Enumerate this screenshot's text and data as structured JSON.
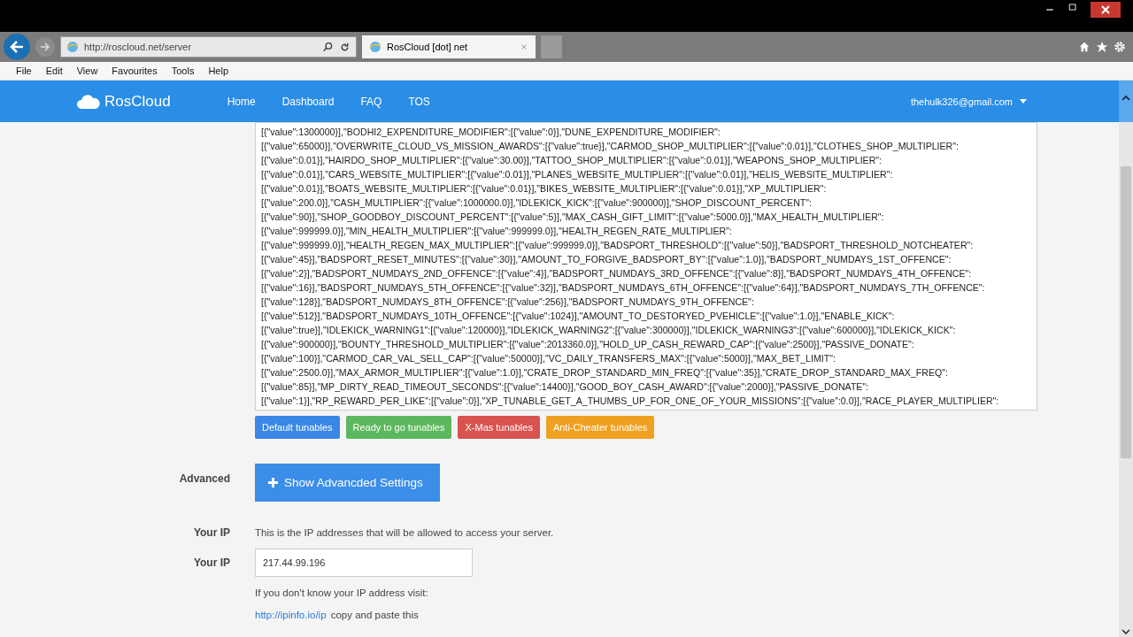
{
  "browser": {
    "address": "http://roscloud.net/server",
    "tab_title": "RosCloud [dot] net",
    "menu": [
      "File",
      "Edit",
      "View",
      "Favourites",
      "Tools",
      "Help"
    ]
  },
  "navbar": {
    "brand": "RosCloud",
    "links": [
      "Home",
      "Dashboard",
      "FAQ",
      "TOS"
    ],
    "user": "thehulk326@gmail.com"
  },
  "tunables_text": {
    "lines": [
      "[{\"value\":1300000}],\"BODHI2_EXPENDITURE_MODIFIER\":[{\"value\":0}],\"DUNE_EXPENDITURE_MODIFIER\":",
      "[{\"value\":65000}],\"OVERWRITE_CLOUD_VS_MISSION_AWARDS\":[{\"value\":true}],\"CARMOD_SHOP_MULTIPLIER\":[{\"value\":0.01}],\"CLOTHES_SHOP_MULTIPLIER\":",
      "[{\"value\":0.01}],\"HAIRDO_SHOP_MULTIPLIER\":[{\"value\":30.00}],\"TATTOO_SHOP_MULTIPLIER\":[{\"value\":0.01}],\"WEAPONS_SHOP_MULTIPLIER\":",
      "[{\"value\":0.01}],\"CARS_WEBSITE_MULTIPLIER\":[{\"value\":0.01}],\"PLANES_WEBSITE_MULTIPLIER\":[{\"value\":0.01}],\"HELIS_WEBSITE_MULTIPLIER\":",
      "[{\"value\":0.01}],\"BOATS_WEBSITE_MULTIPLIER\":[{\"value\":0.01}],\"BIKES_WEBSITE_MULTIPLIER\":[{\"value\":0.01}],\"XP_MULTIPLIER\":",
      "[{\"value\":200.0}],\"CASH_MULTIPLIER\":[{\"value\":1000000.0}],\"IDLEKICK_KICK\":[{\"value\":900000}],\"SHOP_DISCOUNT_PERCENT\":",
      "[{\"value\":90}],\"SHOP_GOODBOY_DISCOUNT_PERCENT\":[{\"value\":5}],\"MAX_CASH_GIFT_LIMIT\":[{\"value\":5000.0}],\"MAX_HEALTH_MULTIPLIER\":",
      "[{\"value\":999999.0}],\"MIN_HEALTH_MULTIPLIER\":[{\"value\":999999.0}],\"HEALTH_REGEN_RATE_MULTIPLIER\":",
      "[{\"value\":999999.0}],\"HEALTH_REGEN_MAX_MULTIPLIER\":[{\"value\":999999.0}],\"BADSPORT_THRESHOLD\":[{\"value\":50}],\"BADSPORT_THRESHOLD_NOTCHEATER\":",
      "[{\"value\":45}],\"BADSPORT_RESET_MINUTES\":[{\"value\":30}],\"AMOUNT_TO_FORGIVE_BADSPORT_BY\":[{\"value\":1.0}],\"BADSPORT_NUMDAYS_1ST_OFFENCE\":",
      "[{\"value\":2}],\"BADSPORT_NUMDAYS_2ND_OFFENCE\":[{\"value\":4}],\"BADSPORT_NUMDAYS_3RD_OFFENCE\":[{\"value\":8}],\"BADSPORT_NUMDAYS_4TH_OFFENCE\":",
      "[{\"value\":16}],\"BADSPORT_NUMDAYS_5TH_OFFENCE\":[{\"value\":32}],\"BADSPORT_NUMDAYS_6TH_OFFENCE\":[{\"value\":64}],\"BADSPORT_NUMDAYS_7TH_OFFENCE\":",
      "[{\"value\":128}],\"BADSPORT_NUMDAYS_8TH_OFFENCE\":[{\"value\":256}],\"BADSPORT_NUMDAYS_9TH_OFFENCE\":",
      "[{\"value\":512}],\"BADSPORT_NUMDAYS_10TH_OFFENCE\":[{\"value\":1024}],\"AMOUNT_TO_DESTORYED_PVEHICLE\":[{\"value\":1.0}],\"ENABLE_KICK\":",
      "[{\"value\":true}],\"IDLEKICK_WARNING1\":[{\"value\":120000}],\"IDLEKICK_WARNING2\":[{\"value\":300000}],\"IDLEKICK_WARNING3\":[{\"value\":600000}],\"IDLEKICK_KICK\":",
      "[{\"value\":900000}],\"BOUNTY_THRESHOLD_MULTIPLIER\":[{\"value\":2013360.0}],\"HOLD_UP_CASH_REWARD_CAP\":[{\"value\":2500}],\"PASSIVE_DONATE\":",
      "[{\"value\":100}],\"CARMOD_CAR_VAL_SELL_CAP\":[{\"value\":50000}],\"VC_DAILY_TRANSFERS_MAX\":[{\"value\":5000}],\"MAX_BET_LIMIT\":",
      "[{\"value\":2500.0}],\"MAX_ARMOR_MULTIPLIER\":[{\"value\":1.0}],\"CRATE_DROP_STANDARD_MIN_FREQ\":[{\"value\":35}],\"CRATE_DROP_STANDARD_MAX_FREQ\":",
      "[{\"value\":85}],\"MP_DIRTY_READ_TIMEOUT_SECONDS\":[{\"value\":14400}],\"GOOD_BOY_CASH_AWARD\":[{\"value\":2000}],\"PASSIVE_DONATE\":",
      "[{\"value\":1}],\"RP_REWARD_PER_LIKE\":[{\"value\":0}],\"XP_TUNABLE_GET_A_THUMBS_UP_FOR_ONE_OF_YOUR_MISSIONS\":[{\"value\":0.0}],\"RACE_PLAYER_MULTIPLIER\":"
    ]
  },
  "preset_buttons": [
    {
      "label": "Default tunables",
      "color": "#3a87e6"
    },
    {
      "label": "Ready to go tunables",
      "color": "#5cb85c"
    },
    {
      "label": "X-Mas tunables",
      "color": "#d9534f"
    },
    {
      "label": "Anti-Cheater tunables",
      "color": "#f0a020"
    }
  ],
  "advanced": {
    "label": "Advanced",
    "button": "Show Advancded Settings"
  },
  "ip_info": {
    "label": "Your IP",
    "text": "This is the IP addresses that will be allowed to access your server."
  },
  "ip_field": {
    "label": "Your IP",
    "value": "217.44.99.196",
    "help": "If you don't know your IP address visit:",
    "link": "http://ipinfo.io/ip",
    "after_link": "copy and paste this"
  }
}
